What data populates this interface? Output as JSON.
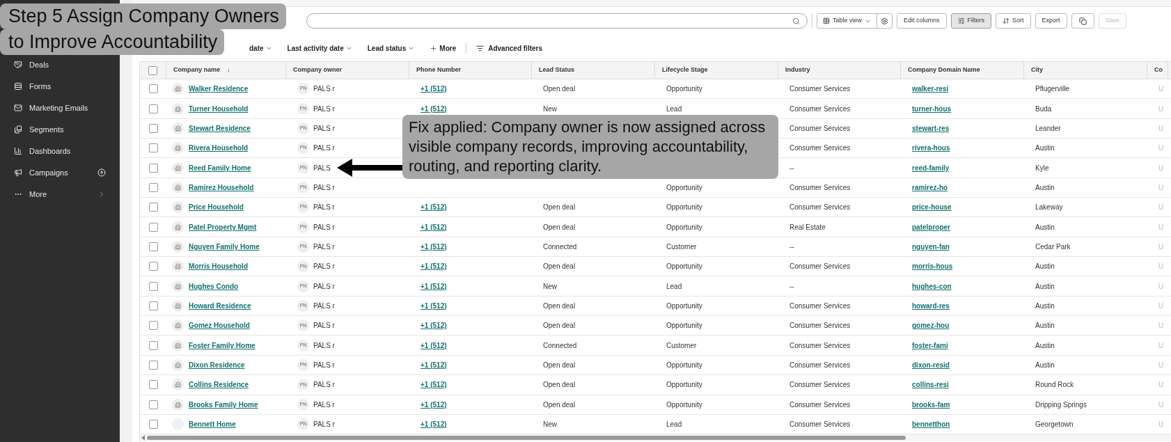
{
  "sidebar": {
    "items": [
      {
        "label": "Deals",
        "badge": false,
        "chevron": false
      },
      {
        "label": "Forms",
        "badge": false,
        "chevron": false
      },
      {
        "label": "Marketing Emails",
        "badge": false,
        "chevron": false
      },
      {
        "label": "Segments",
        "badge": false,
        "chevron": false
      },
      {
        "label": "Dashboards",
        "badge": false,
        "chevron": false
      },
      {
        "label": "Campaigns",
        "badge": true,
        "chevron": false
      },
      {
        "label": "More",
        "badge": false,
        "chevron": true
      }
    ]
  },
  "toolbar": [
    {
      "kind": "view",
      "label": "Table view",
      "active": false,
      "disabled": false
    },
    {
      "kind": "text",
      "label": "Edit columns",
      "active": false,
      "disabled": false
    },
    {
      "kind": "filters",
      "label": "Filters",
      "active": true,
      "disabled": false
    },
    {
      "kind": "sort",
      "label": "Sort",
      "active": false,
      "disabled": false
    },
    {
      "kind": "text",
      "label": "Export",
      "active": false,
      "disabled": false
    },
    {
      "kind": "copy",
      "active": false,
      "disabled": false
    },
    {
      "kind": "text",
      "label": "Save",
      "active": false,
      "disabled": true
    }
  ],
  "filters": [
    {
      "kind": "dropdown",
      "label": "date"
    },
    {
      "kind": "dropdown",
      "label": "Last activity date"
    },
    {
      "kind": "dropdown",
      "label": "Lead status"
    },
    {
      "kind": "more",
      "label": "More"
    },
    {
      "kind": "advanced",
      "label": "Advanced filters"
    }
  ],
  "table": {
    "all_checked": false,
    "columns": [
      {
        "label": "Company name",
        "sort": "↓"
      },
      {
        "label": "Company owner"
      },
      {
        "label": "Phone Number"
      },
      {
        "label": "Lead Status"
      },
      {
        "label": "Lifecycle Stage"
      },
      {
        "label": "Industry"
      },
      {
        "label": "Company Domain Name"
      },
      {
        "label": "City"
      },
      {
        "label": "Co"
      }
    ],
    "rows": [
      {
        "checked": false,
        "logo": true,
        "name": "Walker Residence",
        "owner_initials": "PN",
        "owner": "PALS r",
        "phone": "+1 (512)",
        "lead_status": "Open deal",
        "lifecycle": "Opportunity",
        "industry": "Consumer Services",
        "domain": "walker-resi",
        "city": "Pflugerville",
        "column_9": "U"
      },
      {
        "checked": false,
        "logo": true,
        "name": "Turner Household",
        "owner_initials": "PN",
        "owner": "PALS r",
        "phone": "+1 (512)",
        "lead_status": "New",
        "lifecycle": "Lead",
        "industry": "Consumer Services",
        "domain": "turner-hous",
        "city": "Buda",
        "column_9": "U"
      },
      {
        "checked": false,
        "logo": true,
        "name": "Stewart Residence",
        "owner_initials": "PN",
        "owner": "PALS r",
        "industry": "Consumer Services",
        "domain": "stewart-res",
        "city": "Leander",
        "column_9": "U"
      },
      {
        "checked": false,
        "logo": true,
        "name": "Rivera Household",
        "owner_initials": "PN",
        "owner": "PALS r",
        "industry": "Consumer Services",
        "domain": "rivera-hous",
        "city": "Austin",
        "column_9": "U"
      },
      {
        "checked": false,
        "logo": true,
        "name": "Reed Family Home",
        "owner_initials": "PN",
        "owner": "PALS",
        "industry": "--",
        "domain": "reed-family",
        "city": "Kyle",
        "column_9": "U"
      },
      {
        "checked": false,
        "logo": true,
        "name": "Ramirez Household",
        "owner_initials": "PN",
        "owner": "PALS r",
        "lifecycle": "Opportunity",
        "industry": "Consumer Services",
        "domain": "ramirez-ho",
        "city": "Austin",
        "column_9": "U"
      },
      {
        "checked": false,
        "logo": true,
        "name": "Price Household",
        "owner_initials": "PN",
        "owner": "PALS r",
        "phone": "+1 (512)",
        "lead_status": "Open deal",
        "lifecycle": "Opportunity",
        "industry": "Consumer Services",
        "domain": "price-house",
        "city": "Lakeway",
        "column_9": "U"
      },
      {
        "checked": false,
        "logo": true,
        "name": "Patel Property Mgmt",
        "owner_initials": "PN",
        "owner": "PALS r",
        "phone": "+1 (512)",
        "lead_status": "Open deal",
        "lifecycle": "Opportunity",
        "industry": "Real Estate",
        "domain": "patelproper",
        "city": "Austin",
        "column_9": "U"
      },
      {
        "checked": false,
        "logo": true,
        "name": "Nguyen Family Home",
        "owner_initials": "PN",
        "owner": "PALS r",
        "phone": "+1 (512)",
        "lead_status": "Connected",
        "lifecycle": "Customer",
        "industry": "--",
        "domain": "nguyen-fan",
        "city": "Cedar Park",
        "column_9": "U"
      },
      {
        "checked": false,
        "logo": true,
        "name": "Morris Household",
        "owner_initials": "PN",
        "owner": "PALS r",
        "phone": "+1 (512)",
        "lead_status": "Open deal",
        "lifecycle": "Opportunity",
        "industry": "Consumer Services",
        "domain": "morris-hous",
        "city": "Austin",
        "column_9": "U"
      },
      {
        "checked": false,
        "logo": true,
        "name": "Hughes Condo",
        "owner_initials": "PN",
        "owner": "PALS r",
        "phone": "+1 (512)",
        "lead_status": "New",
        "lifecycle": "Lead",
        "industry": "--",
        "domain": "hughes-con",
        "city": "Austin",
        "column_9": "U"
      },
      {
        "checked": false,
        "logo": true,
        "name": "Howard Residence",
        "owner_initials": "PN",
        "owner": "PALS r",
        "phone": "+1 (512)",
        "lead_status": "Open deal",
        "lifecycle": "Opportunity",
        "industry": "Consumer Services",
        "domain": "howard-res",
        "city": "Austin",
        "column_9": "U"
      },
      {
        "checked": false,
        "logo": true,
        "name": "Gomez Household",
        "owner_initials": "PN",
        "owner": "PALS r",
        "phone": "+1 (512)",
        "lead_status": "Open deal",
        "lifecycle": "Opportunity",
        "industry": "Consumer Services",
        "domain": "gomez-hou",
        "city": "Austin",
        "column_9": "U"
      },
      {
        "checked": false,
        "logo": true,
        "name": "Foster Family Home",
        "owner_initials": "PN",
        "owner": "PALS r",
        "phone": "+1 (512)",
        "lead_status": "Connected",
        "lifecycle": "Customer",
        "industry": "Consumer Services",
        "domain": "foster-fami",
        "city": "Austin",
        "column_9": "U"
      },
      {
        "checked": false,
        "logo": true,
        "name": "Dixon Residence",
        "owner_initials": "PN",
        "owner": "PALS r",
        "phone": "+1 (512)",
        "lead_status": "Open deal",
        "lifecycle": "Opportunity",
        "industry": "Consumer Services",
        "domain": "dixon-resid",
        "city": "Austin",
        "column_9": "U"
      },
      {
        "checked": false,
        "logo": true,
        "name": "Collins Residence",
        "owner_initials": "PN",
        "owner": "PALS r",
        "phone": "+1 (512)",
        "lead_status": "Open deal",
        "lifecycle": "Opportunity",
        "industry": "Consumer Services",
        "domain": "collins-resi",
        "city": "Round Rock",
        "column_9": "U"
      },
      {
        "checked": false,
        "logo": true,
        "name": "Brooks Family Home",
        "owner_initials": "PN",
        "owner": "PALS r",
        "phone": "+1 (512)",
        "lead_status": "Open deal",
        "lifecycle": "Opportunity",
        "industry": "Consumer Services",
        "domain": "brooks-fam",
        "city": "Dripping Springs",
        "column_9": "U"
      },
      {
        "checked": false,
        "logo": false,
        "name": "Bennett Home",
        "owner_initials": "PN",
        "owner": "PALS r",
        "phone": "+1 (512)",
        "lead_status": "New",
        "lifecycle": "Lead",
        "industry": "Consumer Services",
        "domain": "bennetthon",
        "city": "Georgetown",
        "column_9": "U"
      }
    ]
  },
  "annotations": {
    "title_lines": [
      "Step 5 Assign Company Owners",
      "to Improve Accountability"
    ],
    "callout": "Fix applied: Company owner is now assigned across visible company records, improving accountability, routing, and reporting clarity."
  }
}
